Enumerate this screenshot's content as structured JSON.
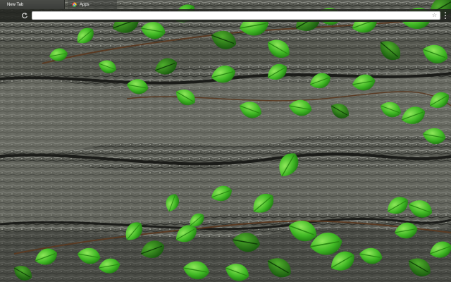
{
  "browser": {
    "tabs": [
      {
        "label": "New Tab",
        "active": true
      },
      {
        "label": "Apps",
        "active": false
      }
    ],
    "omnibox": {
      "value": "",
      "placeholder": ""
    },
    "icons": {
      "reload": "reload-icon",
      "star": "bookmark-star-icon",
      "menu": "menu-icon",
      "apps": "apps-icon"
    }
  },
  "colors": {
    "bark": "#4b4d47",
    "bark_light": "#8a8c84",
    "leaf": "#39b51f",
    "leaf_light": "#7fe04a",
    "toolbar": "#222420"
  }
}
